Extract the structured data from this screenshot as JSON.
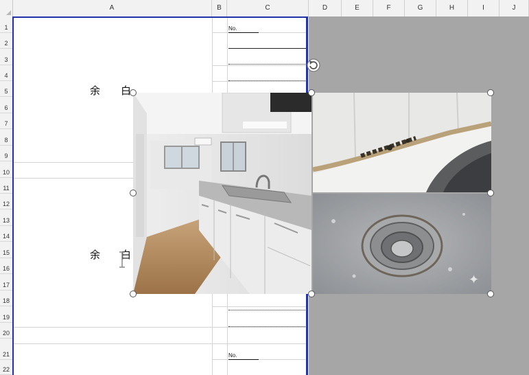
{
  "columns": [
    {
      "label": "A"
    },
    {
      "label": "B"
    },
    {
      "label": "C"
    },
    {
      "label": "D"
    },
    {
      "label": "E"
    },
    {
      "label": "F"
    },
    {
      "label": "G"
    },
    {
      "label": "H"
    },
    {
      "label": "I"
    },
    {
      "label": "J"
    }
  ],
  "rows": [
    "1",
    "2",
    "3",
    "4",
    "5",
    "6",
    "7",
    "8",
    "9",
    "10",
    "11",
    "12",
    "13",
    "14",
    "15",
    "16",
    "17",
    "18",
    "19",
    "20",
    "21",
    "22"
  ],
  "sheet": {
    "margin_label_top": "余　　白",
    "margin_label_bottom": "余　　白",
    "no_label_1": "No.",
    "no_label_2": "No."
  },
  "photos": {
    "kitchen": "kitchen-photo",
    "mold": "caulk-mold-photo",
    "drain": "sink-drain-photo"
  },
  "colors": {
    "print_border": "#2233aa",
    "out_of_print_area": "#a6a6a6"
  },
  "icons": [
    "rotate-handle-icon",
    "text-cursor-icon",
    "sparkle-icon"
  ]
}
